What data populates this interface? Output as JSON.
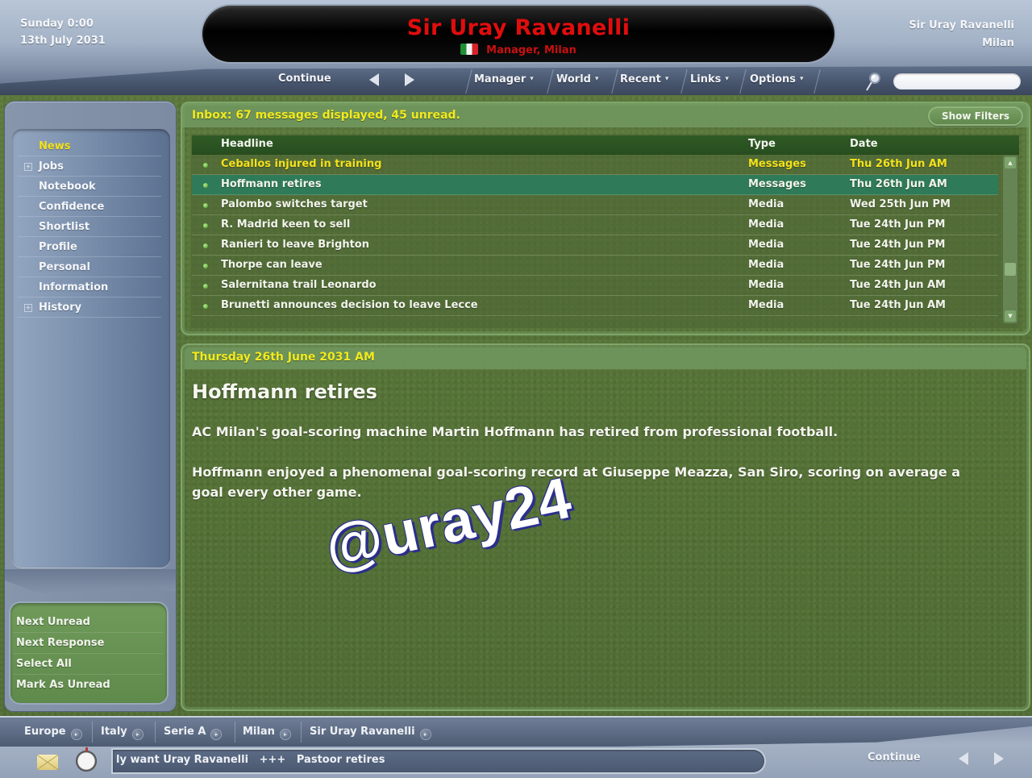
{
  "header": {
    "day_time": "Sunday 0:00",
    "date": "13th July 2031",
    "manager_name": "Sir Uray Ravanelli",
    "manager_role": "Manager, Milan",
    "flag": "italy-flag",
    "user_name": "Sir Uray Ravanelli",
    "user_club": "Milan"
  },
  "nav": {
    "continue_label": "Continue",
    "back_icon": "arrow-left-icon",
    "forward_icon": "arrow-right-icon",
    "menus": [
      {
        "label": "Manager"
      },
      {
        "label": "World"
      },
      {
        "label": "Recent"
      },
      {
        "label": "Links"
      },
      {
        "label": "Options"
      }
    ],
    "search_placeholder": ""
  },
  "sidebar": {
    "items": [
      {
        "label": "News",
        "active": true,
        "expandable": false
      },
      {
        "label": "Jobs",
        "active": false,
        "expandable": true
      },
      {
        "label": "Notebook",
        "active": false,
        "expandable": false
      },
      {
        "label": "Confidence",
        "active": false,
        "expandable": false
      },
      {
        "label": "Shortlist",
        "active": false,
        "expandable": false
      },
      {
        "label": "Profile",
        "active": false,
        "expandable": false
      },
      {
        "label": "Personal",
        "active": false,
        "expandable": false
      },
      {
        "label": "Information",
        "active": false,
        "expandable": false
      },
      {
        "label": "History",
        "active": false,
        "expandable": true
      }
    ],
    "expander_glyph": "+",
    "actions": [
      {
        "label": "Next Unread"
      },
      {
        "label": "Next Response"
      },
      {
        "label": "Select All"
      },
      {
        "label": "Mark As Unread"
      }
    ]
  },
  "inbox": {
    "title": "Inbox: 67 messages displayed, 45 unread.",
    "show_filters_label": "Show Filters",
    "columns": {
      "headline": "Headline",
      "type": "Type",
      "date": "Date"
    },
    "rows": [
      {
        "headline": "Ceballos injured in training",
        "type": "Messages",
        "date": "Thu 26th Jun AM",
        "unread": true,
        "selected": false
      },
      {
        "headline": "Hoffmann retires",
        "type": "Messages",
        "date": "Thu 26th Jun AM",
        "unread": false,
        "selected": true
      },
      {
        "headline": "Palombo switches target",
        "type": "Media",
        "date": "Wed 25th Jun PM",
        "unread": false,
        "selected": false
      },
      {
        "headline": "R. Madrid keen to sell",
        "type": "Media",
        "date": "Tue 24th Jun PM",
        "unread": false,
        "selected": false
      },
      {
        "headline": "Ranieri to leave Brighton",
        "type": "Media",
        "date": "Tue 24th Jun PM",
        "unread": false,
        "selected": false
      },
      {
        "headline": "Thorpe can leave",
        "type": "Media",
        "date": "Tue 24th Jun PM",
        "unread": false,
        "selected": false
      },
      {
        "headline": "Salernitana trail Leonardo",
        "type": "Media",
        "date": "Tue 24th Jun AM",
        "unread": false,
        "selected": false
      },
      {
        "headline": "Brunetti announces decision to leave Lecce",
        "type": "Media",
        "date": "Tue 24th Jun AM",
        "unread": false,
        "selected": false
      }
    ],
    "scroll_up_glyph": "▲",
    "scroll_down_glyph": "▼"
  },
  "message": {
    "date": "Thursday 26th June 2031 AM",
    "title": "Hoffmann retires",
    "paragraphs": [
      "AC Milan's goal-scoring machine Martin Hoffmann has retired from professional football.",
      "Hoffmann enjoyed a phenomenal goal-scoring record at Giuseppe Meazza, San Siro, scoring on average a goal every other game."
    ],
    "watermark": "@uray24"
  },
  "footer": {
    "breadcrumbs": [
      {
        "label": "Europe"
      },
      {
        "label": "Italy"
      },
      {
        "label": "Serie A"
      },
      {
        "label": "Milan"
      },
      {
        "label": "Sir Uray Ravanelli"
      }
    ],
    "crumb_glyph": "▸",
    "ticker_text": "ly want Uray Ravanelli   +++   Pastoor retires",
    "continue_label": "Continue"
  },
  "colors": {
    "highlight_yellow": "#f4e21a",
    "title_red": "#e00d0d",
    "selected_row": "#2f7a58",
    "table_header": "#2b5422"
  }
}
